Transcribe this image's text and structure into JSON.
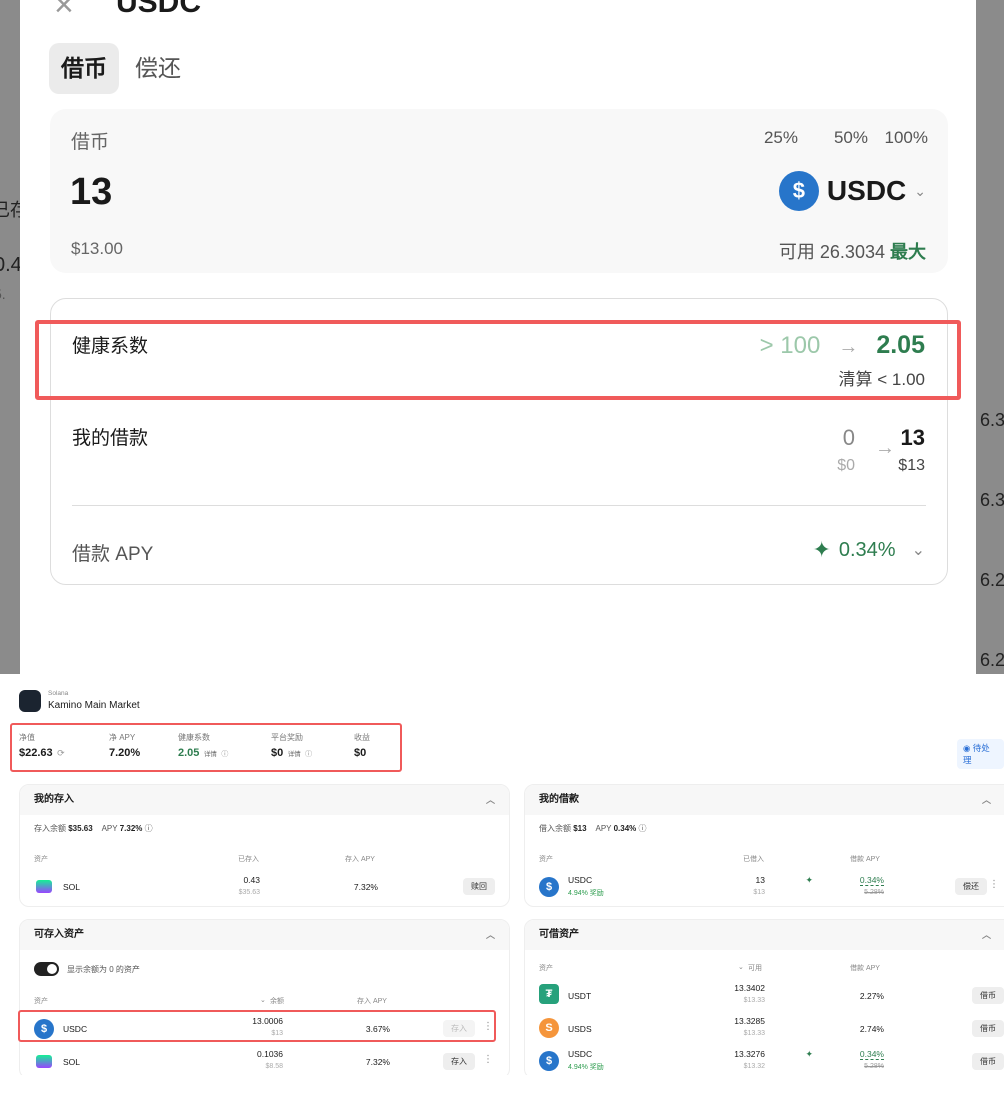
{
  "background": {
    "left_texts": [
      "已存",
      "0.4",
      "5."
    ],
    "right_texts": [
      "6.3",
      "6.3",
      "6.2",
      "6.2"
    ]
  },
  "modal": {
    "title": "USDC",
    "close_icon": "×",
    "tabs": [
      {
        "label": "借币",
        "active": true
      },
      {
        "label": "偿还",
        "active": false
      }
    ],
    "input": {
      "label": "借币",
      "amount": "13",
      "usd": "$13.00",
      "presets": [
        "25%",
        "50%",
        "100%"
      ],
      "token": "USDC",
      "available_label": "可用",
      "available": "26.3034",
      "max": "最大"
    },
    "health": {
      "label": "健康系数",
      "from": "> 100",
      "to": "2.05",
      "liquidation": "清算 < 1.00"
    },
    "loan": {
      "label": "我的借款",
      "from": "0",
      "from_usd": "$0",
      "to": "13",
      "to_usd": "$13"
    },
    "apy": {
      "label": "借款 APY",
      "value": "0.34%"
    }
  },
  "dashboard": {
    "network": "Solana",
    "market": "Kamino Main Market",
    "pending": "待处理",
    "stats": [
      {
        "label": "净值",
        "value": "$22.63"
      },
      {
        "label": "净 APY",
        "value": "7.20%"
      },
      {
        "label": "健康系数",
        "value": "2.05",
        "detail": "详情"
      },
      {
        "label": "平台奖励",
        "value": "$0",
        "detail": "详情"
      },
      {
        "label": "收益",
        "value": "$0"
      }
    ],
    "deposits": {
      "title": "我的存入",
      "balance_label": "存入余额",
      "balance": "$35.63",
      "apy_label": "APY",
      "apy": "7.32%",
      "headers": [
        "资产",
        "已存入",
        "存入 APY"
      ],
      "rows": [
        {
          "asset": "SOL",
          "amount": "0.43",
          "usd": "$35.63",
          "apy": "7.32%",
          "action": "赎回"
        }
      ]
    },
    "borrows": {
      "title": "我的借款",
      "balance_label": "借入余额",
      "balance": "$13",
      "apy_label": "APY",
      "apy": "0.34%",
      "headers": [
        "资产",
        "已借入",
        "借款 APY"
      ],
      "rows": [
        {
          "asset": "USDC",
          "reward": "4.94% 奖励",
          "amount": "13",
          "usd": "$13",
          "apy": "0.34%",
          "old_apy": "5.28%",
          "action": "偿还"
        }
      ]
    },
    "supply": {
      "title": "可存入资产",
      "toggle_label": "显示余额为 0 的资产",
      "headers": [
        "资产",
        "余额",
        "存入 APY"
      ],
      "rows": [
        {
          "asset": "USDC",
          "amount": "13.0006",
          "usd": "$13",
          "apy": "3.67%",
          "action": "存入"
        },
        {
          "asset": "SOL",
          "amount": "0.1036",
          "usd": "$8.58",
          "apy": "7.32%",
          "action": "存入"
        }
      ]
    },
    "borrowable": {
      "title": "可借资产",
      "headers": [
        "资产",
        "可用",
        "借款 APY"
      ],
      "rows": [
        {
          "asset": "USDT",
          "amount": "13.3402",
          "usd": "$13.33",
          "apy": "2.27%",
          "action": "借币"
        },
        {
          "asset": "USDS",
          "amount": "13.3285",
          "usd": "$13.33",
          "apy": "2.74%",
          "action": "借币"
        },
        {
          "asset": "USDC",
          "reward": "4.94% 奖励",
          "amount": "13.3276",
          "usd": "$13.32",
          "apy": "0.34%",
          "old_apy": "5.28%",
          "action": "借币"
        }
      ]
    }
  },
  "colors": {
    "accent_green": "#2e7d4f",
    "highlight_red": "#f05a5a",
    "usdc_blue": "#2775ca"
  }
}
